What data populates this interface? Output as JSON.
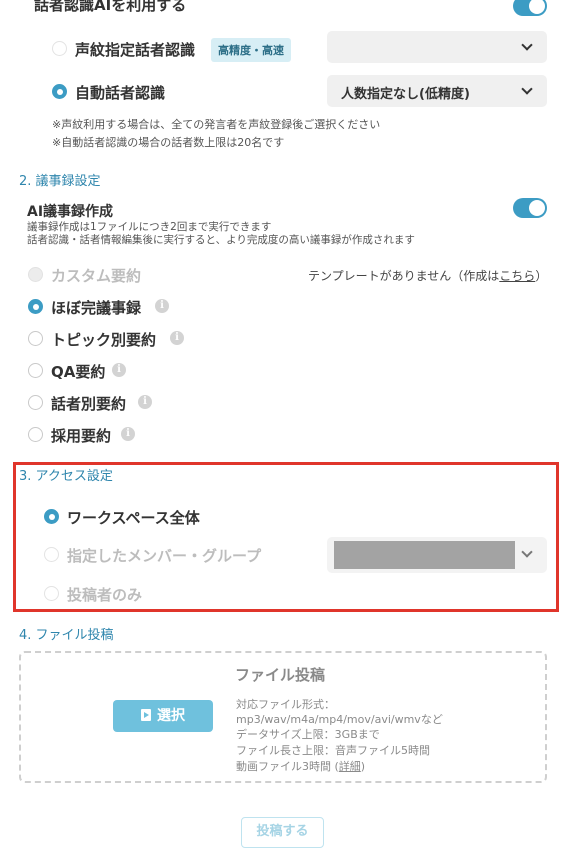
{
  "speaker": {
    "heading": "話者認識AIを利用する",
    "voiceprint_label": "声紋指定話者認識",
    "voiceprint_badge": "高精度・高速",
    "voiceprint_select_value": "",
    "auto_label": "自動話者認識",
    "auto_select_value": "人数指定なし(低精度)",
    "note1": "※声紋利用する場合は、全ての発言者を声紋登録後ご選択ください",
    "note2": "※自動話者認識の場合の話者数上限は20名です"
  },
  "minutes": {
    "section_title": "2. 議事録設定",
    "heading": "AI議事録作成",
    "desc1": "議事録作成は1ファイルにつき2回まで実行できます",
    "desc2": "話者認識・話者情報編集後に実行すると、より完成度の高い議事録が作成されます",
    "custom_label": "カスタム要約",
    "template_note_prefix": "テンプレートがありません（作成は",
    "template_link": "こちら",
    "template_note_suffix": "）",
    "options": [
      "ほぼ完議事録",
      "トピック別要約",
      "QA要約",
      "話者別要約",
      "採用要約"
    ],
    "selected": "ほぼ完議事録"
  },
  "access": {
    "section_title": "3. アクセス設定",
    "options": [
      "ワークスペース全体",
      "指定したメンバー・グループ",
      "投稿者のみ"
    ],
    "selected": "ワークスペース全体"
  },
  "upload": {
    "section_title": "4. ファイル投稿",
    "title": "ファイル投稿",
    "select_button": "選択",
    "formats_label": "対応ファイル形式：",
    "formats": "mp3/wav/m4a/mp4/mov/avi/wmvなど",
    "size_limit": "データサイズ上限：3GBまで",
    "length_limit": "ファイル長さ上限：音声ファイル5時間",
    "video_limit_prefix": "動画ファイル3時間 (",
    "details_link": "詳細",
    "video_limit_suffix": ")",
    "submit_button": "投稿する"
  },
  "colors": {
    "accent": "#3c9cc4",
    "highlight": "#e0352b",
    "button": "#6fc1dd"
  },
  "icons": {
    "info": "info-icon",
    "chevron": "chevron-down-icon",
    "file": "file-play-icon"
  }
}
